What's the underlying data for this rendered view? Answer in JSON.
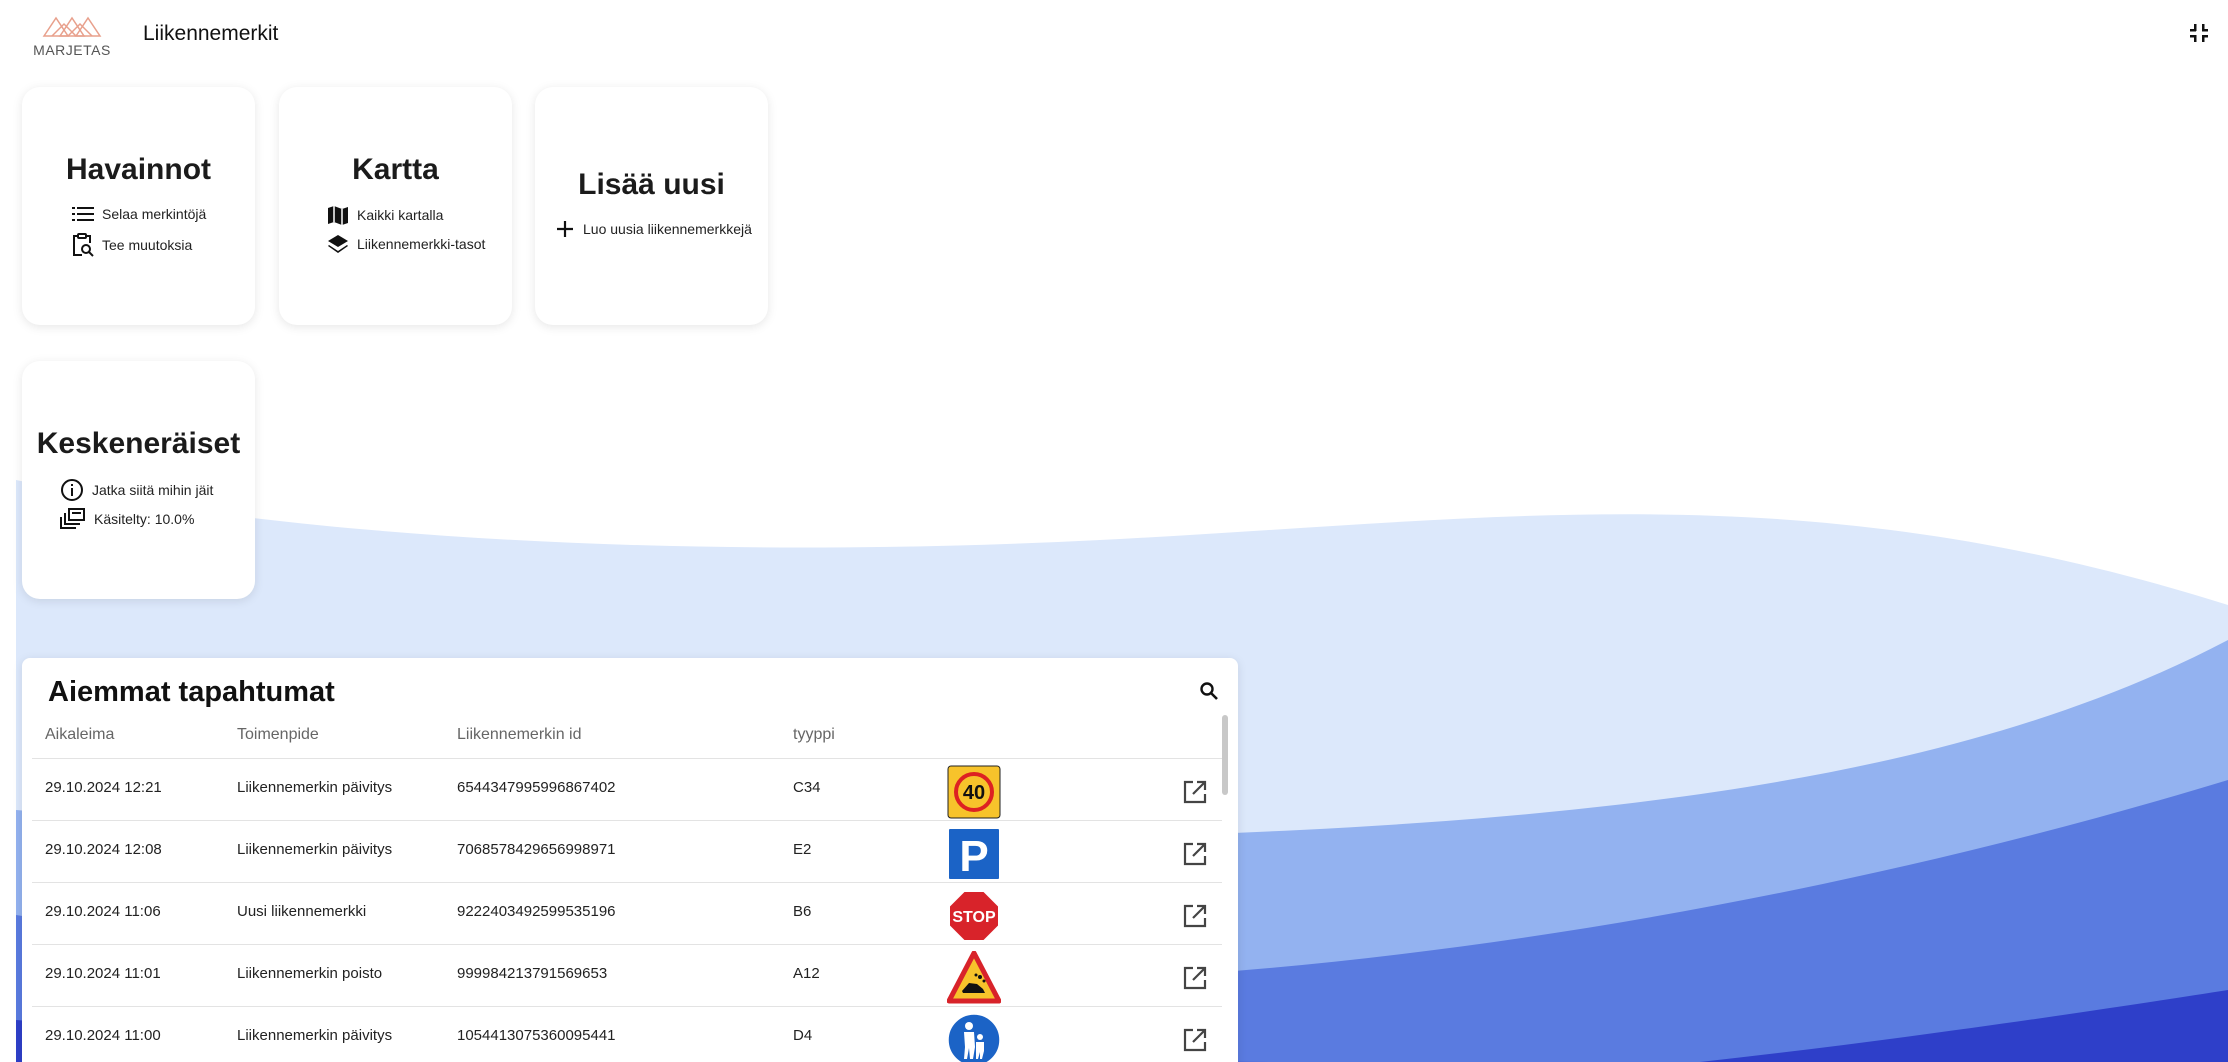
{
  "header": {
    "logo_text": "MARJETAS",
    "title": "Liikennemerkit",
    "collapse_icon": "fullscreen-exit-icon"
  },
  "colors": {
    "wave_light": "#dce8fb",
    "wave_mid": "#93b2f0",
    "wave_strong": "#5a7be0",
    "wave_dark": "#2e3fc9",
    "logo": "#e8a08c"
  },
  "cards": {
    "havainnot": {
      "title": "Havainnot",
      "items": [
        {
          "icon": "list-icon",
          "label": "Selaa merkintöjä"
        },
        {
          "icon": "clipboard-search-icon",
          "label": "Tee muutoksia"
        }
      ]
    },
    "kartta": {
      "title": "Kartta",
      "items": [
        {
          "icon": "map-icon",
          "label": "Kaikki kartalla"
        },
        {
          "icon": "layers-icon",
          "label": "Liikennemerkki-tasot"
        }
      ]
    },
    "lisaa": {
      "title": "Lisää uusi",
      "items": [
        {
          "icon": "plus-icon",
          "label": "Luo uusia liikennemerkkejä"
        }
      ]
    },
    "kesken": {
      "title": "Keskeneräiset",
      "items": [
        {
          "icon": "info-icon",
          "label": "Jatka siitä mihin jäit"
        },
        {
          "icon": "library-icon",
          "label": "Käsitelty: 10.0%"
        }
      ]
    }
  },
  "events": {
    "title": "Aiemmat tapahtumat",
    "columns": [
      "Aikaleima",
      "Toimenpide",
      "Liikennemerkin id",
      "tyyppi"
    ],
    "rows": [
      {
        "time": "29.10.2024 12:21",
        "action": "Liikennemerkin päivitys",
        "id": "6544347995996867402",
        "type": "C34",
        "sign": "speed-limit-40-sign",
        "sign_text": "40"
      },
      {
        "time": "29.10.2024 12:08",
        "action": "Liikennemerkin päivitys",
        "id": "7068578429656998971",
        "type": "E2",
        "sign": "parking-sign",
        "sign_text": "P"
      },
      {
        "time": "29.10.2024 11:06",
        "action": "Uusi liikennemerkki",
        "id": "9222403492599535196",
        "type": "B6",
        "sign": "stop-sign",
        "sign_text": "STOP"
      },
      {
        "time": "29.10.2024 11:01",
        "action": "Liikennemerkin poisto",
        "id": "999984213791569653",
        "type": "A12",
        "sign": "loose-gravel-warning-sign",
        "sign_text": ""
      },
      {
        "time": "29.10.2024 11:00",
        "action": "Liikennemerkin päivitys",
        "id": "1054413075360095441",
        "type": "D4",
        "sign": "pedestrian-path-sign",
        "sign_text": ""
      }
    ]
  }
}
